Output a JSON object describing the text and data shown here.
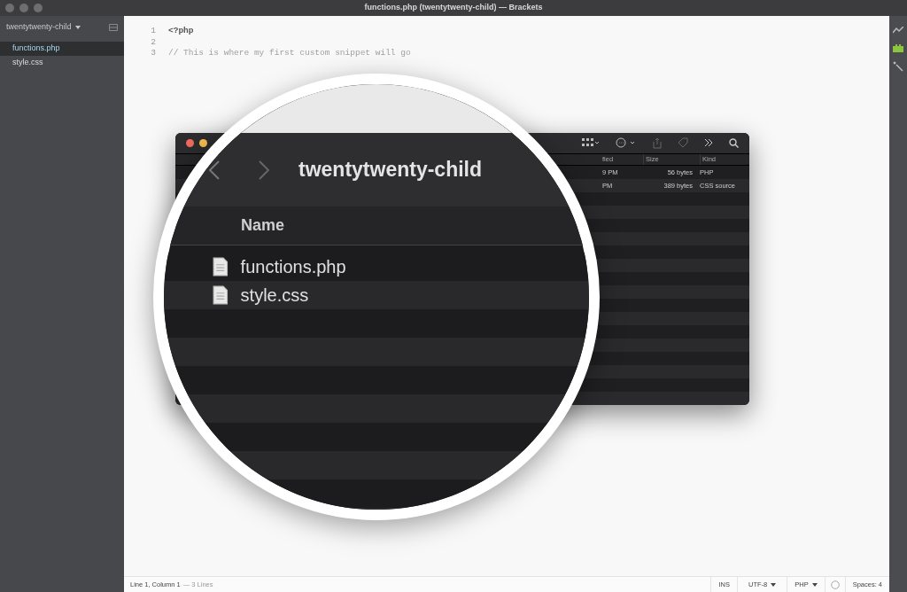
{
  "window": {
    "title": "functions.php (twentytwenty-child) — Brackets"
  },
  "sidebar": {
    "project": "twentytwenty-child",
    "files": [
      {
        "name": "functions.php",
        "selected": true
      },
      {
        "name": "style.css",
        "selected": false
      }
    ]
  },
  "editor": {
    "lines": [
      {
        "number": "1",
        "text": "<?php",
        "kind": "code"
      },
      {
        "number": "2"
      },
      {
        "number": "3",
        "text": "// This is where my first custom snippet will go",
        "kind": "comment"
      }
    ]
  },
  "status_bar": {
    "position": "Line 1, Column 1",
    "line_count": "— 3 Lines",
    "mode": "INS",
    "encoding": "UTF-8",
    "language": "PHP",
    "indent": "Spaces: 4"
  },
  "finder": {
    "columns": [
      {
        "label": "fied"
      },
      {
        "label": "Size"
      },
      {
        "label": "Kind"
      }
    ],
    "rows": [
      {
        "modified": "9 PM",
        "size": "56 bytes",
        "kind": "PHP"
      },
      {
        "modified": "PM",
        "size": "389 bytes",
        "kind": "CSS source"
      }
    ]
  },
  "magnifier": {
    "title": "twentytwenty-child",
    "column": "Name",
    "files": [
      {
        "name": "functions.php"
      },
      {
        "name": "style.css"
      }
    ]
  }
}
